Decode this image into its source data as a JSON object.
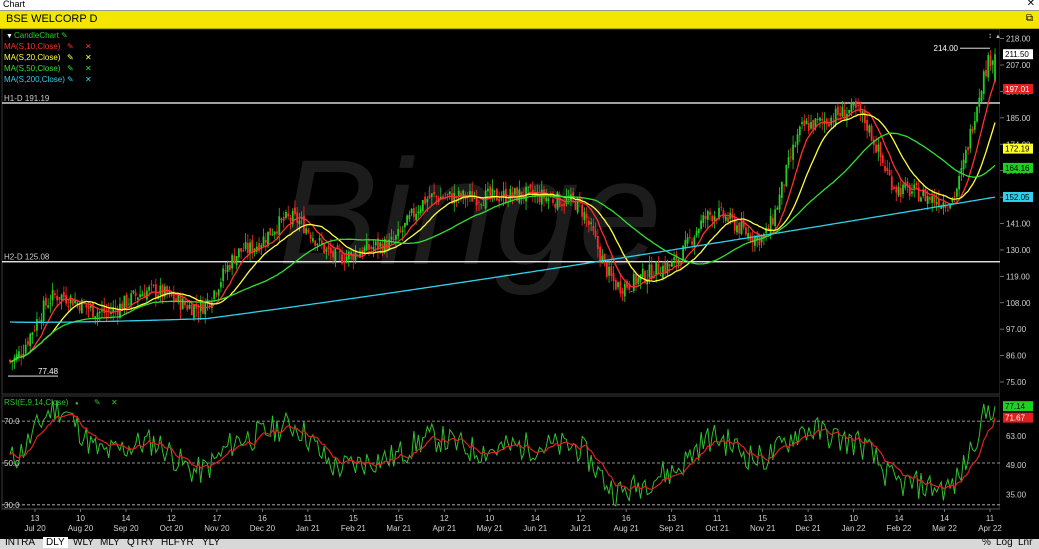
{
  "window": {
    "title": "Chart",
    "symbol": "BSE WELCORP D"
  },
  "legend": {
    "candle": "CandleChart",
    "ma": [
      {
        "label": "MA(S,10,Close)",
        "color": "#ff3030"
      },
      {
        "label": "MA(S,20,Close)",
        "color": "#ffff40"
      },
      {
        "label": "MA(S,50,Close)",
        "color": "#30e030"
      },
      {
        "label": "MA(S,200,Close)",
        "color": "#30d0e8"
      }
    ],
    "rsi": "RSI(E,9,14,Close)"
  },
  "hlines": {
    "h1": "H1-D 191.19",
    "h2": "H2-D 125.08"
  },
  "annotations": {
    "high": "214.00",
    "low": "77.48"
  },
  "badges": {
    "last": "211.50",
    "ma10": "197.01",
    "ma20": "172.19",
    "ma50": "164.16",
    "ma200": "152.05",
    "rsi": "77.14",
    "rsi_signal": "71.67"
  },
  "price_ticks": [
    "218.00",
    "207.00",
    "196.00",
    "185.00",
    "174.00",
    "163.00",
    "152.00",
    "141.00",
    "130.00",
    "119.00",
    "108.00",
    "97.00",
    "86.00",
    "75.00"
  ],
  "rsi_ticks": [
    "63.00",
    "49.00",
    "35.00"
  ],
  "rsi_left_labels": [
    "70.0",
    "50.0",
    "30.0"
  ],
  "x_axis": [
    {
      "day": "13",
      "mon": "Jul 20"
    },
    {
      "day": "10",
      "mon": "Aug 20"
    },
    {
      "day": "14",
      "mon": "Sep 20"
    },
    {
      "day": "12",
      "mon": "Oct 20"
    },
    {
      "day": "17",
      "mon": "Nov 20"
    },
    {
      "day": "16",
      "mon": "Dec 20"
    },
    {
      "day": "11",
      "mon": "Jan 21"
    },
    {
      "day": "15",
      "mon": "Feb 21"
    },
    {
      "day": "15",
      "mon": "Mar 21"
    },
    {
      "day": "12",
      "mon": "Apr 21"
    },
    {
      "day": "10",
      "mon": "May 21"
    },
    {
      "day": "14",
      "mon": "Jun 21"
    },
    {
      "day": "12",
      "mon": "Jul 21"
    },
    {
      "day": "16",
      "mon": "Aug 21"
    },
    {
      "day": "13",
      "mon": "Sep 21"
    },
    {
      "day": "11",
      "mon": "Oct 21"
    },
    {
      "day": "15",
      "mon": "Nov 21"
    },
    {
      "day": "13",
      "mon": "Dec 21"
    },
    {
      "day": "10",
      "mon": "Jan 22"
    },
    {
      "day": "14",
      "mon": "Feb 22"
    },
    {
      "day": "14",
      "mon": "Mar 22"
    },
    {
      "day": "11",
      "mon": "Apr 22"
    }
  ],
  "watermark": "Binge",
  "toolbar": {
    "timeframes": [
      "INTRA",
      "DLY",
      "WLY",
      "MLY",
      "QTRY",
      "HLFYR",
      "YLY"
    ],
    "active": "DLY",
    "right": [
      "%",
      "Log",
      "Lnr"
    ]
  },
  "chart_data": [
    {
      "type": "candlestick",
      "title": "BSE WELCORP D",
      "ylim": [
        70,
        222
      ],
      "grid": false,
      "legend": "top-left",
      "key_points": [
        {
          "date": "Jul 20",
          "close": 84
        },
        {
          "date": "Aug 20",
          "close": 111
        },
        {
          "date": "Sep 20",
          "close": 104
        },
        {
          "date": "Oct 20",
          "close": 113
        },
        {
          "date": "Nov 20",
          "close": 106
        },
        {
          "date": "Dec 20",
          "close": 130
        },
        {
          "date": "Jan 21",
          "close": 143
        },
        {
          "date": "Feb 21",
          "close": 127
        },
        {
          "date": "Mar 21",
          "close": 132
        },
        {
          "date": "Apr 21",
          "close": 152
        },
        {
          "date": "May 21",
          "close": 152
        },
        {
          "date": "Jun 21",
          "close": 153
        },
        {
          "date": "Jul 21",
          "close": 150
        },
        {
          "date": "Aug 21",
          "close": 115
        },
        {
          "date": "Sep 21",
          "close": 123
        },
        {
          "date": "Oct 21",
          "close": 145
        },
        {
          "date": "Nov 21",
          "close": 135
        },
        {
          "date": "Dec 21",
          "close": 182
        },
        {
          "date": "Jan 22",
          "close": 188
        },
        {
          "date": "Feb 22",
          "close": 155
        },
        {
          "date": "Mar 22",
          "close": 150
        },
        {
          "date": "Apr 22",
          "close": 211.5
        }
      ],
      "series": [
        {
          "name": "MA(S,10,Close)",
          "last": 197.01
        },
        {
          "name": "MA(S,20,Close)",
          "last": 172.19
        },
        {
          "name": "MA(S,50,Close)",
          "last": 164.16
        },
        {
          "name": "MA(S,200,Close)",
          "last": 152.05
        }
      ],
      "hlines": [
        191.19,
        125.08
      ],
      "high": 214.0,
      "low": 77.48
    },
    {
      "type": "line",
      "title": "RSI(E,9,14,Close)",
      "ylim": [
        28,
        82
      ],
      "series": [
        {
          "name": "RSI(E,9,14,Close)",
          "last": 77.14
        },
        {
          "name": "signal",
          "last": 71.67
        }
      ],
      "key_points": [
        {
          "date": "Jul 20",
          "value": 52
        },
        {
          "date": "Aug 20",
          "value": 76
        },
        {
          "date": "Sep 20",
          "value": 55
        },
        {
          "date": "Oct 20",
          "value": 60
        },
        {
          "date": "Nov 20",
          "value": 46
        },
        {
          "date": "Dec 20",
          "value": 62
        },
        {
          "date": "Jan 21",
          "value": 68
        },
        {
          "date": "Feb 21",
          "value": 48
        },
        {
          "date": "Mar 21",
          "value": 52
        },
        {
          "date": "Apr 21",
          "value": 62
        },
        {
          "date": "May 21",
          "value": 56
        },
        {
          "date": "Jun 21",
          "value": 58
        },
        {
          "date": "Jul 21",
          "value": 58
        },
        {
          "date": "Aug 21",
          "value": 36
        },
        {
          "date": "Sep 21",
          "value": 45
        },
        {
          "date": "Oct 21",
          "value": 62
        },
        {
          "date": "Nov 21",
          "value": 52
        },
        {
          "date": "Dec 21",
          "value": 66
        },
        {
          "date": "Jan 22",
          "value": 60
        },
        {
          "date": "Feb 22",
          "value": 40
        },
        {
          "date": "Mar 22",
          "value": 38
        },
        {
          "date": "Apr 22",
          "value": 77.14
        }
      ],
      "levels": [
        70,
        50,
        30
      ]
    }
  ]
}
